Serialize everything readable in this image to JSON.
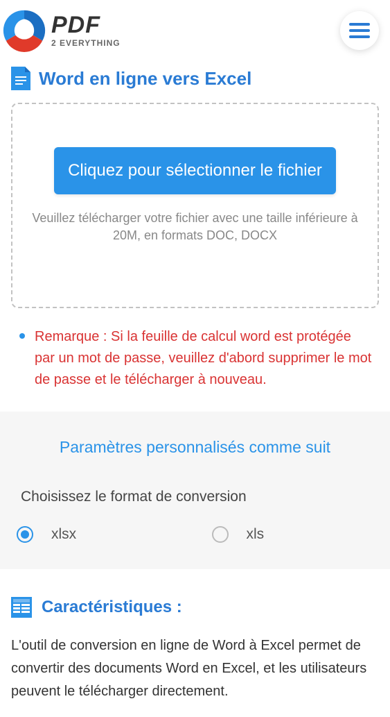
{
  "logo": {
    "main": "PDF",
    "sub": "2 EVERYTHING"
  },
  "page": {
    "title": "Word en ligne vers Excel"
  },
  "upload": {
    "button": "Cliquez pour sélectionner le fichier",
    "hint": "Veuillez télécharger votre fichier avec une taille inférieure à 20M, en formats DOC, DOCX"
  },
  "note": {
    "text": "Remarque : Si la feuille de calcul word est protégée par un mot de passe, veuillez d'abord supprimer le mot de passe et le télécharger à nouveau."
  },
  "settings": {
    "title": "Paramètres personnalisés comme suit",
    "format_label": "Choisissez le format de conversion",
    "options": {
      "xlsx": "xlsx",
      "xls": "xls"
    },
    "selected": "xlsx"
  },
  "features": {
    "title": "Caractéristiques :",
    "body": "L'outil de conversion en ligne de Word à Excel permet de convertir des documents Word en Excel, et les utilisateurs peuvent le télécharger directement."
  }
}
